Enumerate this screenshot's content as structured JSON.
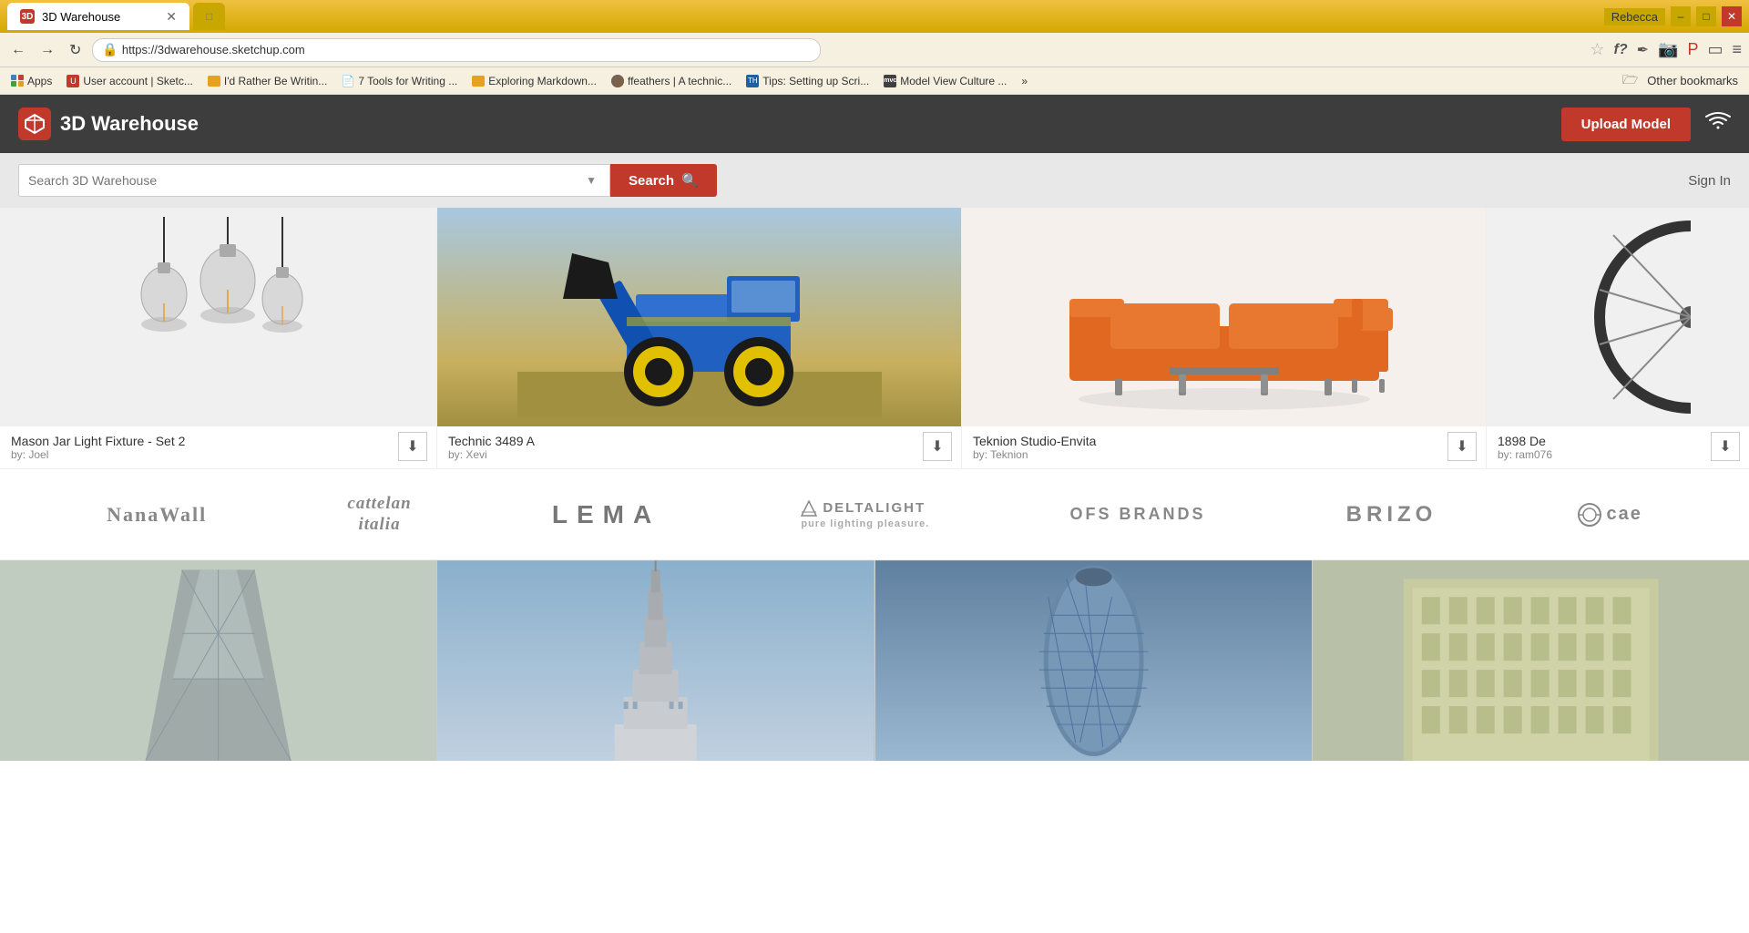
{
  "browser": {
    "tab_title": "3D Warehouse",
    "tab_favicon": "3D",
    "address": "https://3dwarehouse.sketchup.com",
    "user": "Rebecca",
    "win_minimize": "–",
    "win_maximize": "□",
    "win_close": "✕"
  },
  "bookmarks": {
    "items": [
      {
        "label": "Apps",
        "type": "grid"
      },
      {
        "label": "User account | Sketc...",
        "type": "favicon",
        "favicon": "U"
      },
      {
        "label": "I'd Rather Be Writin...",
        "type": "folder"
      },
      {
        "label": "7 Tools for Writing ...",
        "type": "page"
      },
      {
        "label": "Exploring Markdown...",
        "type": "folder"
      },
      {
        "label": "ffeathers | A technic...",
        "type": "avatar"
      },
      {
        "label": "Tips: Setting up Scri...",
        "type": "th"
      },
      {
        "label": "Model View Culture ...",
        "type": "mvc"
      },
      {
        "label": "»",
        "type": "more"
      }
    ],
    "other": "Other bookmarks"
  },
  "site": {
    "logo_text": "3D Warehouse",
    "upload_button": "Upload Model",
    "search_placeholder": "Search 3D Warehouse",
    "search_button": "Search",
    "sign_in": "Sign In"
  },
  "models": [
    {
      "title": "Mason Jar Light Fixture - Set 2",
      "author": "by: Joel",
      "type": "mason-jar"
    },
    {
      "title": "Technic 3489 A",
      "author": "by: Xevi",
      "type": "technic"
    },
    {
      "title": "Teknion Studio-Envita",
      "author": "by: Teknion",
      "type": "sofa"
    },
    {
      "title": "1898 De",
      "author": "by: ram076",
      "type": "partial"
    }
  ],
  "brands": [
    {
      "name": "NanaWall",
      "class": "brand-nanawall"
    },
    {
      "name": "cattelan italia",
      "class": "brand-cattelan"
    },
    {
      "name": "LEMA",
      "class": "brand-lema"
    },
    {
      "name": "✕ DELTALIGHT\npure lighting pleasure.",
      "class": "brand-deltalight"
    },
    {
      "name": "OFS BRANDS",
      "class": "brand-ofs"
    },
    {
      "name": "BRIZO",
      "class": "brand-brizo"
    },
    {
      "name": "◎ cae",
      "class": "brand-cae"
    }
  ],
  "buildings": [
    {
      "type": "skyscraper1",
      "bg": "#c8d4c0"
    },
    {
      "type": "skyscraper2",
      "bg": "#b8c8d8"
    },
    {
      "type": "skyscraper3",
      "bg": "#a8b8c8"
    },
    {
      "type": "skyscraper4",
      "bg": "#c0c8b0"
    }
  ]
}
